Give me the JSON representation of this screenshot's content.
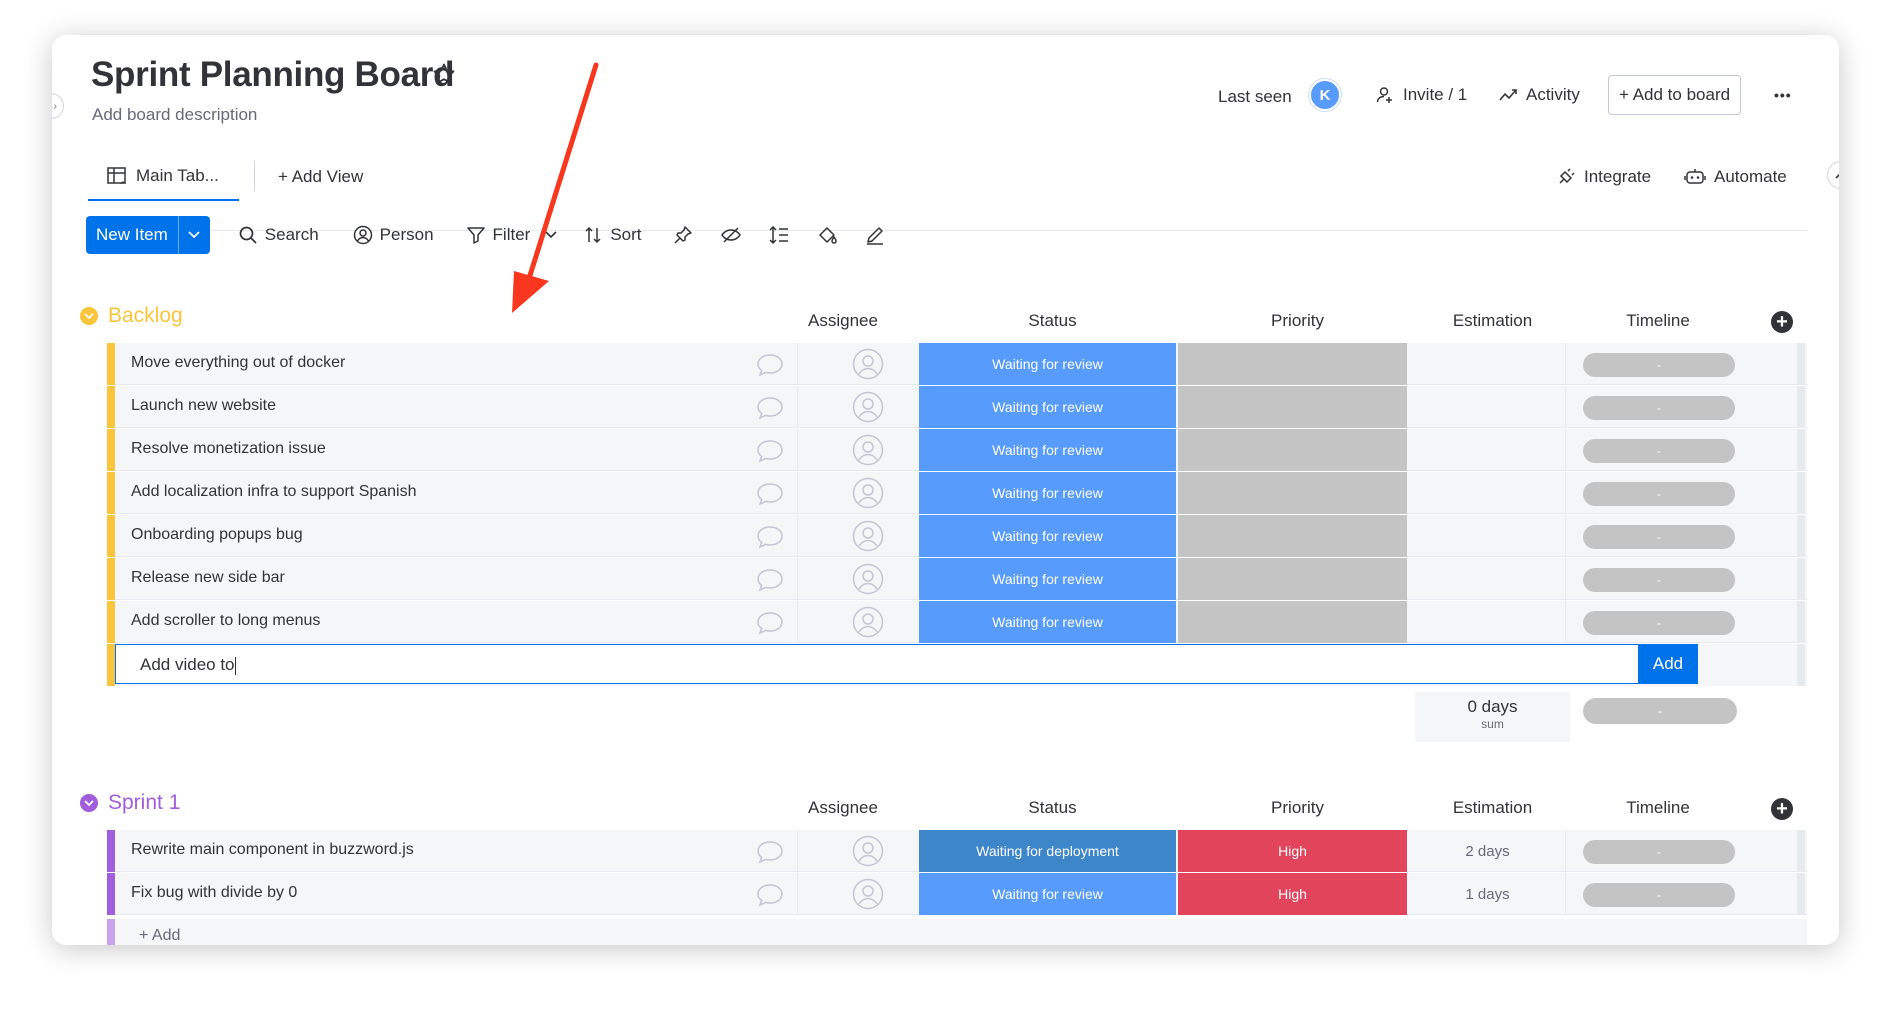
{
  "board": {
    "title": "Sprint Planning Board",
    "description": "Add board description"
  },
  "header": {
    "last_seen_label": "Last seen",
    "avatar_initial": "K",
    "invite_label": "Invite / 1",
    "activity_label": "Activity",
    "add_to_board_label": "+ Add to board",
    "more_label": "•••"
  },
  "tabs": {
    "main_table": "Main Tab...",
    "add_view": "+ Add View",
    "integrate": "Integrate",
    "automate": "Automate"
  },
  "toolbar": {
    "new_item": "New Item",
    "search": "Search",
    "person": "Person",
    "filter": "Filter",
    "sort": "Sort"
  },
  "columns": {
    "assignee": "Assignee",
    "status": "Status",
    "priority": "Priority",
    "estimation": "Estimation",
    "timeline": "Timeline"
  },
  "colors": {
    "backlog": "#f9c53c",
    "sprint": "#a25ddc",
    "waiting_review": "#579bfc",
    "waiting_deploy": "#3c86c9",
    "high": "#e2445c",
    "empty_priority": "#c4c4c4",
    "arrow": "#f9361e"
  },
  "groups": [
    {
      "title": "Backlog",
      "items": [
        {
          "name": "Move everything out of docker",
          "status": "Waiting for review",
          "priority": "",
          "estimation": "",
          "timeline": "-"
        },
        {
          "name": "Launch new website",
          "status": "Waiting for review",
          "priority": "",
          "estimation": "",
          "timeline": "-"
        },
        {
          "name": "Resolve monetization issue",
          "status": "Waiting for review",
          "priority": "",
          "estimation": "",
          "timeline": "-"
        },
        {
          "name": "Add localization infra to support Spanish",
          "status": "Waiting for review",
          "priority": "",
          "estimation": "",
          "timeline": "-"
        },
        {
          "name": "Onboarding popups bug",
          "status": "Waiting for review",
          "priority": "",
          "estimation": "",
          "timeline": "-"
        },
        {
          "name": "Release new side bar",
          "status": "Waiting for review",
          "priority": "",
          "estimation": "",
          "timeline": "-"
        },
        {
          "name": "Add scroller to long menus",
          "status": "Waiting for review",
          "priority": "",
          "estimation": "",
          "timeline": "-"
        }
      ],
      "add_input_value": "Add video to",
      "add_button": "Add",
      "sum_value": "0 days",
      "sum_label": "sum",
      "sum_timeline": "-"
    },
    {
      "title": "Sprint 1",
      "items": [
        {
          "name": "Rewrite main component in buzzword.js",
          "status": "Waiting for deployment",
          "priority": "High",
          "estimation": "2 days",
          "timeline": "-"
        },
        {
          "name": "Fix bug with divide by 0",
          "status": "Waiting for review",
          "priority": "High",
          "estimation": "1 days",
          "timeline": "-"
        }
      ],
      "add_label": "+ Add"
    }
  ]
}
